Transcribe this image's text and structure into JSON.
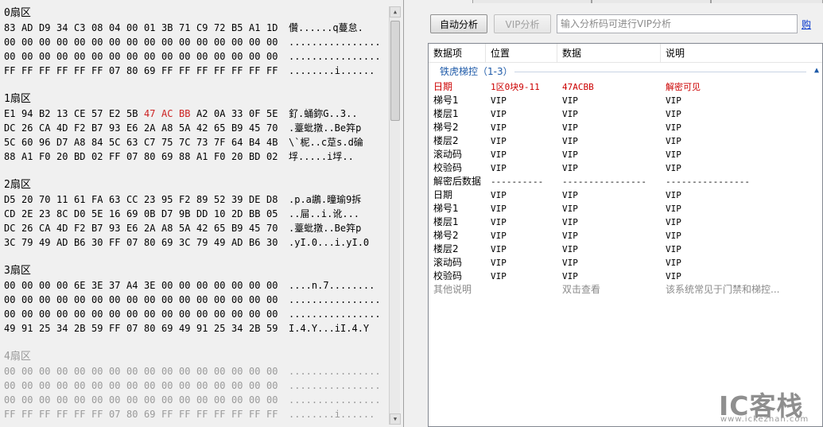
{
  "hex_view": {
    "sectors": [
      {
        "title": "0扇区",
        "dim": false,
        "rows": [
          {
            "bytes": [
              "83",
              "AD",
              "D9",
              "34",
              "C3",
              "08",
              "04",
              "00",
              "01",
              "3B",
              "71",
              "C9",
              "72",
              "B5",
              "A1",
              "1D"
            ],
            "highlight": [],
            "ascii": "儹......q蔓怠."
          },
          {
            "bytes": [
              "00",
              "00",
              "00",
              "00",
              "00",
              "00",
              "00",
              "00",
              "00",
              "00",
              "00",
              "00",
              "00",
              "00",
              "00",
              "00"
            ],
            "highlight": [],
            "ascii": "................"
          },
          {
            "bytes": [
              "00",
              "00",
              "00",
              "00",
              "00",
              "00",
              "00",
              "00",
              "00",
              "00",
              "00",
              "00",
              "00",
              "00",
              "00",
              "00"
            ],
            "highlight": [],
            "ascii": "................"
          },
          {
            "bytes": [
              "FF",
              "FF",
              "FF",
              "FF",
              "FF",
              "FF",
              "07",
              "80",
              "69",
              "FF",
              "FF",
              "FF",
              "FF",
              "FF",
              "FF",
              "FF"
            ],
            "highlight": [],
            "ascii": "........i......"
          }
        ]
      },
      {
        "title": "1扇区",
        "dim": false,
        "rows": [
          {
            "bytes": [
              "E1",
              "94",
              "B2",
              "13",
              "CE",
              "57",
              "E2",
              "5B",
              "47",
              "AC",
              "BB",
              "A2",
              "0A",
              "33",
              "0F",
              "5E"
            ],
            "highlight": [
              8,
              9,
              10
            ],
            "ascii": "釕.蛹鉨G..3.."
          },
          {
            "bytes": [
              "DC",
              "26",
              "CA",
              "4D",
              "F2",
              "B7",
              "93",
              "E6",
              "2A",
              "A8",
              "5A",
              "42",
              "65",
              "B9",
              "45",
              "70"
            ],
            "highlight": [],
            "ascii": ".薹蚍撴..Be筓p"
          },
          {
            "bytes": [
              "5C",
              "60",
              "96",
              "D7",
              "A8",
              "84",
              "5C",
              "63",
              "C7",
              "75",
              "7C",
              "73",
              "7F",
              "64",
              "B4",
              "4B"
            ],
            "highlight": [],
            "ascii": "\\`柅..c莡s.d碖"
          },
          {
            "bytes": [
              "88",
              "A1",
              "F0",
              "20",
              "BD",
              "02",
              "FF",
              "07",
              "80",
              "69",
              "88",
              "A1",
              "F0",
              "20",
              "BD",
              "02"
            ],
            "highlight": [],
            "ascii": "垺.....i垺.."
          }
        ]
      },
      {
        "title": "2扇区",
        "dim": false,
        "rows": [
          {
            "bytes": [
              "D5",
              "20",
              "70",
              "11",
              "61",
              "FA",
              "63",
              "CC",
              "23",
              "95",
              "F2",
              "89",
              "52",
              "39",
              "DE",
              "D8"
            ],
            "highlight": [],
            "ascii": ".p.a鶘.曈瑜9拆"
          },
          {
            "bytes": [
              "CD",
              "2E",
              "23",
              "8C",
              "D0",
              "5E",
              "16",
              "69",
              "0B",
              "D7",
              "9B",
              "DD",
              "10",
              "2D",
              "BB",
              "05"
            ],
            "highlight": [],
            "ascii": "..屇..i.讹..."
          },
          {
            "bytes": [
              "DC",
              "26",
              "CA",
              "4D",
              "F2",
              "B7",
              "93",
              "E6",
              "2A",
              "A8",
              "5A",
              "42",
              "65",
              "B9",
              "45",
              "70"
            ],
            "highlight": [],
            "ascii": ".薹蚍撴..Be筓p"
          },
          {
            "bytes": [
              "3C",
              "79",
              "49",
              "AD",
              "B6",
              "30",
              "FF",
              "07",
              "80",
              "69",
              "3C",
              "79",
              "49",
              "AD",
              "B6",
              "30"
            ],
            "highlight": [],
            "ascii": ".yI.0...i.yI.0"
          }
        ]
      },
      {
        "title": "3扇区",
        "dim": false,
        "rows": [
          {
            "bytes": [
              "00",
              "00",
              "00",
              "00",
              "6E",
              "3E",
              "37",
              "A4",
              "3E",
              "00",
              "00",
              "00",
              "00",
              "00",
              "00",
              "00"
            ],
            "highlight": [],
            "ascii": "....n.7........"
          },
          {
            "bytes": [
              "00",
              "00",
              "00",
              "00",
              "00",
              "00",
              "00",
              "00",
              "00",
              "00",
              "00",
              "00",
              "00",
              "00",
              "00",
              "00"
            ],
            "highlight": [],
            "ascii": "................"
          },
          {
            "bytes": [
              "00",
              "00",
              "00",
              "00",
              "00",
              "00",
              "00",
              "00",
              "00",
              "00",
              "00",
              "00",
              "00",
              "00",
              "00",
              "00"
            ],
            "highlight": [],
            "ascii": "................"
          },
          {
            "bytes": [
              "49",
              "91",
              "25",
              "34",
              "2B",
              "59",
              "FF",
              "07",
              "80",
              "69",
              "49",
              "91",
              "25",
              "34",
              "2B",
              "59"
            ],
            "highlight": [],
            "ascii": "I.4.Y...iI.4.Y"
          }
        ]
      },
      {
        "title": "4扇区",
        "dim": true,
        "rows": [
          {
            "bytes": [
              "00",
              "00",
              "00",
              "00",
              "00",
              "00",
              "00",
              "00",
              "00",
              "00",
              "00",
              "00",
              "00",
              "00",
              "00",
              "00"
            ],
            "highlight": [],
            "ascii": "................"
          },
          {
            "bytes": [
              "00",
              "00",
              "00",
              "00",
              "00",
              "00",
              "00",
              "00",
              "00",
              "00",
              "00",
              "00",
              "00",
              "00",
              "00",
              "00"
            ],
            "highlight": [],
            "ascii": "................"
          },
          {
            "bytes": [
              "00",
              "00",
              "00",
              "00",
              "00",
              "00",
              "00",
              "00",
              "00",
              "00",
              "00",
              "00",
              "00",
              "00",
              "00",
              "00"
            ],
            "highlight": [],
            "ascii": "................"
          },
          {
            "bytes": [
              "FF",
              "FF",
              "FF",
              "FF",
              "FF",
              "FF",
              "07",
              "80",
              "69",
              "FF",
              "FF",
              "FF",
              "FF",
              "FF",
              "FF",
              "FF"
            ],
            "highlight": [],
            "ascii": "........i......"
          }
        ]
      }
    ]
  },
  "toolbar": {
    "auto_label": "自动分析",
    "vip_label": "VIP分析",
    "input_placeholder": "输入分析码可进行VIP分析",
    "buy_label": "购"
  },
  "results": {
    "columns": {
      "item": "数据项",
      "position": "位置",
      "data": "数据",
      "description": "说明"
    },
    "group_title": "铁虎梯控（1-3）",
    "rows": [
      {
        "style": "red",
        "item": "日期",
        "position": "1区0块9-11",
        "data": "47ACBB",
        "description": "解密可见"
      },
      {
        "style": "normal",
        "item": "梯号1",
        "position": "VIP",
        "data": "VIP",
        "description": "VIP"
      },
      {
        "style": "normal",
        "item": "楼层1",
        "position": "VIP",
        "data": "VIP",
        "description": "VIP"
      },
      {
        "style": "normal",
        "item": "梯号2",
        "position": "VIP",
        "data": "VIP",
        "description": "VIP"
      },
      {
        "style": "normal",
        "item": "楼层2",
        "position": "VIP",
        "data": "VIP",
        "description": "VIP"
      },
      {
        "style": "normal",
        "item": "滚动码",
        "position": "VIP",
        "data": "VIP",
        "description": "VIP"
      },
      {
        "style": "normal",
        "item": "校验码",
        "position": "VIP",
        "data": "VIP",
        "description": "VIP"
      },
      {
        "style": "normal",
        "item": "解密后数据",
        "position": "----------",
        "data": "----------------",
        "description": "----------------"
      },
      {
        "style": "normal",
        "item": "日期",
        "position": "VIP",
        "data": "VIP",
        "description": "VIP"
      },
      {
        "style": "normal",
        "item": "梯号1",
        "position": "VIP",
        "data": "VIP",
        "description": "VIP"
      },
      {
        "style": "normal",
        "item": "楼层1",
        "position": "VIP",
        "data": "VIP",
        "description": "VIP"
      },
      {
        "style": "normal",
        "item": "梯号2",
        "position": "VIP",
        "data": "VIP",
        "description": "VIP"
      },
      {
        "style": "normal",
        "item": "楼层2",
        "position": "VIP",
        "data": "VIP",
        "description": "VIP"
      },
      {
        "style": "normal",
        "item": "滚动码",
        "position": "VIP",
        "data": "VIP",
        "description": "VIP"
      },
      {
        "style": "normal",
        "item": "校验码",
        "position": "VIP",
        "data": "VIP",
        "description": "VIP"
      },
      {
        "style": "gray",
        "item": "其他说明",
        "position": "",
        "data": "双击查看",
        "description": "该系统常见于门禁和梯控..."
      }
    ]
  },
  "watermark": {
    "logo": "IC客栈",
    "url": "www.ickezhan.com"
  },
  "icons": {
    "group_collapse": "chevron-up-icon",
    "scroll_up": "arrow-up-icon",
    "scroll_down": "arrow-down-icon"
  },
  "colors": {
    "highlight_red": "#cc2222",
    "group_blue": "#1e5aa8",
    "link_blue": "#0033cc"
  }
}
